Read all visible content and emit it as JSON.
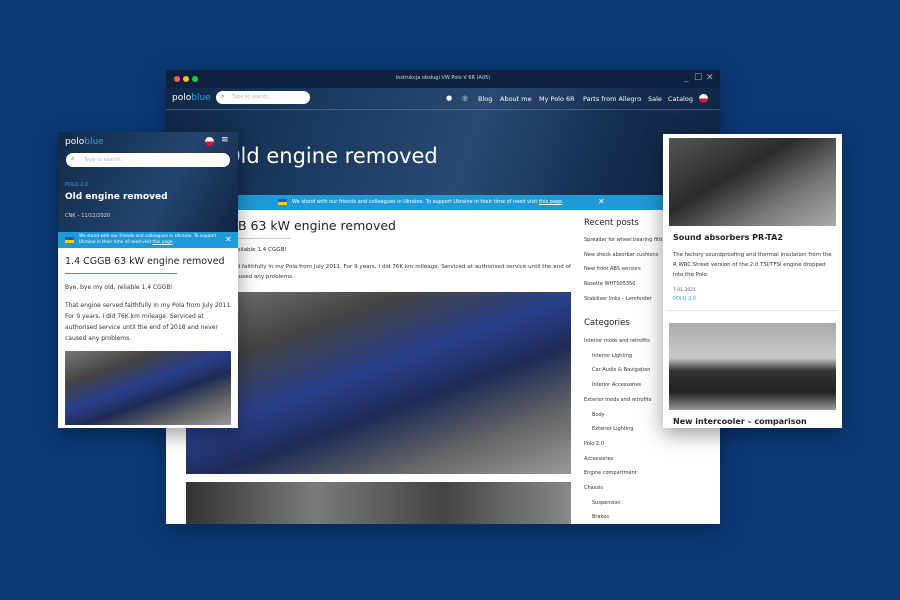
{
  "window": {
    "title": "Instrukcja obsługi VW Polo V 6R (A05)",
    "controls": [
      "_",
      "☐",
      "✕"
    ]
  },
  "site": {
    "logo_a": "polo",
    "logo_b": "blue",
    "search_placeholder": "Type to search...",
    "nav": [
      "Blog",
      "About me",
      "My Polo 6R",
      "Parts from Allegro",
      "Sale",
      "Catalog"
    ]
  },
  "hero": {
    "category": "POLO 2.0",
    "title": "Old engine removed",
    "meta": "CNK – 11/12/2020"
  },
  "banner": {
    "text": "We stand with our friends and colleagues in Ukraine. To support Ukraine in their time of need visit ",
    "link": "this page",
    "end": "."
  },
  "article": {
    "title": "1.4 CGGB 63 kW engine removed",
    "lead": "Bye, bye my old, reliable 1.4 CGGB!",
    "body": "That engine served faithfully in my Pola from July 2011. For 9 years, I did 76K km mileage. Serviced at authorised service until the end of 2018 and never caused any problems."
  },
  "sidebar": {
    "recent_title": "Recent posts",
    "recent": [
      "Spreader for wheel bearing fitting",
      "New shock absorber cushions",
      "New front ABS sensors",
      "Rosette WHT005350",
      "Stabiliser links – Lemforder"
    ],
    "categories_title": "Categories",
    "categories": [
      {
        "label": "Interior mods and retrofits",
        "sub": false
      },
      {
        "label": "Interior Lighting",
        "sub": true
      },
      {
        "label": "Car Audio & Navigation",
        "sub": true
      },
      {
        "label": "Interior Accessories",
        "sub": true
      },
      {
        "label": "Exterior mods and retrofits",
        "sub": false
      },
      {
        "label": "Body",
        "sub": true
      },
      {
        "label": "Exterior Lighting",
        "sub": true
      },
      {
        "label": "Polo 2.0",
        "sub": false
      },
      {
        "label": "Accessories",
        "sub": false
      },
      {
        "label": "Engine compartment",
        "sub": false
      },
      {
        "label": "Chassis",
        "sub": false
      },
      {
        "label": "Suspension",
        "sub": true
      },
      {
        "label": "Brakes",
        "sub": true
      }
    ]
  },
  "cards": [
    {
      "title": "Sound absorbers PR-TA2",
      "text": "The factory soundproofing and thermal insulation from the R WRC Street version of the 2.0 TSI/TFSI engine dropped into the Polo.",
      "date": "7.01.2021",
      "category": "POLO 2.0"
    },
    {
      "title": "New intercooler – comparison"
    }
  ],
  "colors": {
    "background": "#0b3a78",
    "accent": "#1e9bd7",
    "nav": "#0d2240"
  }
}
